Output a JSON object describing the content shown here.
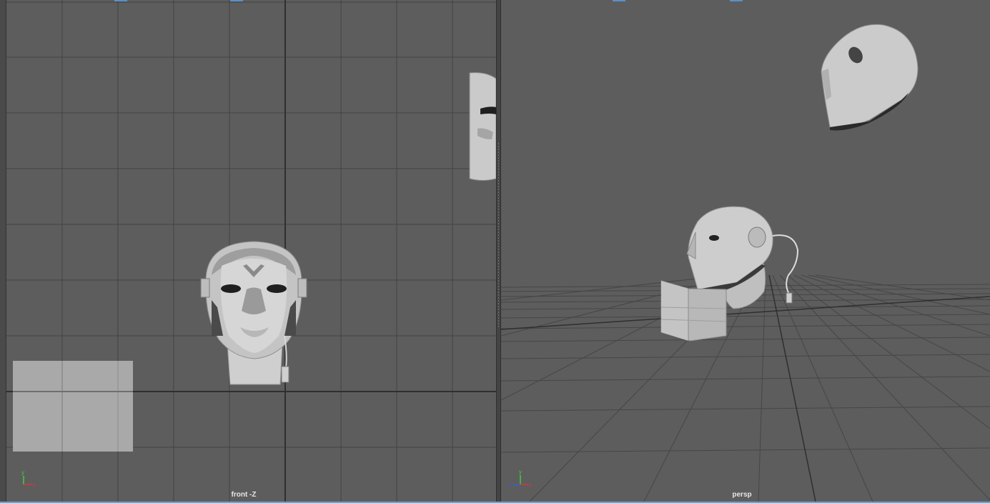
{
  "viewports": {
    "front": {
      "camera_label": "front -Z"
    },
    "persp": {
      "camera_label": "persp"
    }
  },
  "axis_gizmo": {
    "y": "y",
    "x": "x",
    "z": "z"
  },
  "colors": {
    "viewport_bg": "#5d5d5d",
    "grid_line": "#404040",
    "grid_axis": "#2c2c2c",
    "mesh": "#c8c8c8",
    "axis_x": "#d43a3a",
    "axis_y": "#3fcf3f",
    "axis_z": "#3a5be0",
    "selection_bar": "#5aa9d8"
  }
}
